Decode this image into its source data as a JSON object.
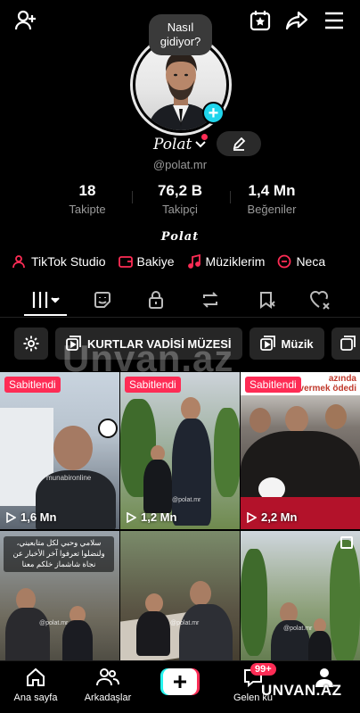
{
  "top_bar": {
    "add_friend_icon": "person-plus-icon",
    "star_calendar_icon": "star-calendar-icon",
    "share_icon": "share-icon",
    "menu_icon": "hamburger-icon"
  },
  "profile": {
    "bubble_text_line1": "Nasıl",
    "bubble_text_line2": "gidiyor?",
    "name": "Polat",
    "handle": "@polat.mr",
    "bio": "Polat",
    "accent_color": "#fe2c55",
    "plus_badge_color": "#20d5ec"
  },
  "stats": [
    {
      "value": "18",
      "label": "Takipte"
    },
    {
      "value": "76,2 B",
      "label": "Takipçi"
    },
    {
      "value": "1,4 Mn",
      "label": "Beğeniler"
    }
  ],
  "links": [
    {
      "icon": "person-icon",
      "label": "TikTok Studio"
    },
    {
      "icon": "wallet-icon",
      "label": "Bakiye"
    },
    {
      "icon": "music-note-icon",
      "label": "Müziklerim"
    },
    {
      "icon": "gift-icon",
      "label": "Neca"
    }
  ],
  "tabs": [
    {
      "icon": "grid-icon"
    },
    {
      "icon": "sticker-icon"
    },
    {
      "icon": "lock-icon"
    },
    {
      "icon": "repost-icon"
    },
    {
      "icon": "bookmark-icon"
    },
    {
      "icon": "heart-icon"
    }
  ],
  "chips": [
    {
      "icon": "gear-icon",
      "label": ""
    },
    {
      "icon": "playlist-icon",
      "label": "KURTLAR VADİSİ MÜZESİ"
    },
    {
      "icon": "playlist-icon",
      "label": "Müzik"
    }
  ],
  "watermark": "Unvan.az",
  "videos": [
    {
      "pinned": "Sabitlendi",
      "views": "1,6 Mn",
      "overlay": "munabironline"
    },
    {
      "pinned": "Sabitlendi",
      "views": "1,2 Mn",
      "overlay": "@polat.mr"
    },
    {
      "pinned": "Sabitlendi",
      "views": "2,2 Mn",
      "overlay_top1": "azında",
      "overlay_top2": "yola vermek ödedi"
    },
    {
      "caption_line1": "سلامي وحبي لكل متابعيني،",
      "caption_line2": "ولنضلوا تعرفوا آخر الأخبار عن",
      "caption_line3": "نجاة شاشماز خلكم معنا",
      "overlay": "@polat.mr"
    },
    {
      "overlay": "@polat.mr"
    },
    {
      "overlay": "@polat.mr"
    }
  ],
  "bottom_nav": {
    "home": "Ana sayfa",
    "friends": "Arkadaşlar",
    "inbox": "Gelen ku",
    "inbox_badge": "99+",
    "brand": "UNVAN.AZ"
  }
}
